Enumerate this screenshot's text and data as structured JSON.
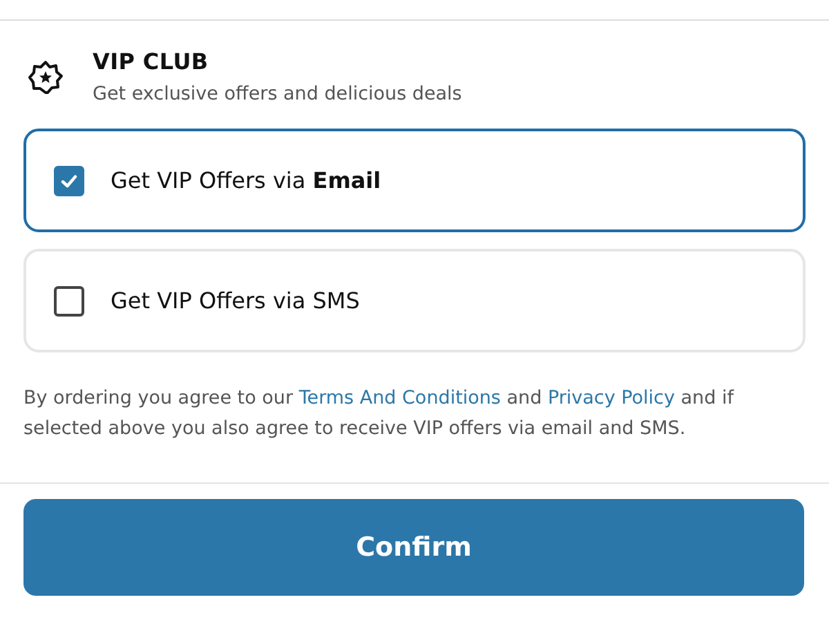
{
  "vip_club": {
    "title": "VIP CLUB",
    "subtitle": "Get exclusive offers and delicious deals"
  },
  "options": [
    {
      "label": "Get VIP Offers via **Email**",
      "checked": true
    },
    {
      "label": "Get VIP Offers via SMS",
      "checked": false
    }
  ],
  "legal": [
    {
      "kind": "text",
      "text": "By ordering you agree to our "
    },
    {
      "kind": "link",
      "text": "Terms And Conditions"
    },
    {
      "kind": "text",
      "text": " and "
    },
    {
      "kind": "link",
      "text": "Privacy Policy"
    },
    {
      "kind": "text",
      "text": " and if selected above you also agree to receive VIP offers via email and SMS."
    }
  ],
  "confirm_button": "Confirm"
}
